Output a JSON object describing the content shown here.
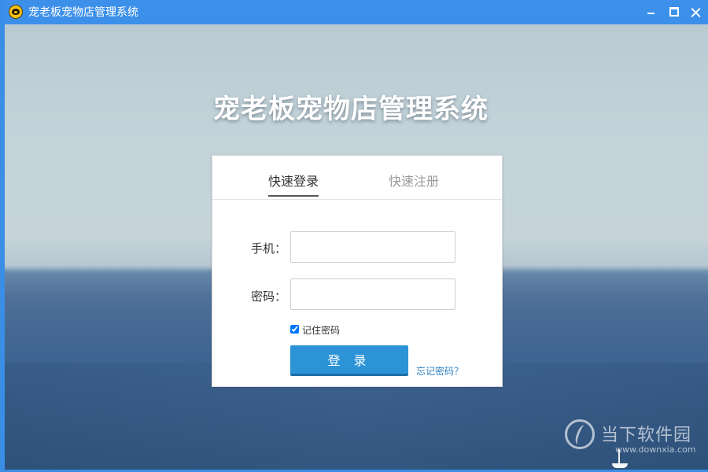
{
  "window": {
    "title": "宠老板宠物店管理系统",
    "icon": "pet-dog-icon"
  },
  "main": {
    "title": "宠老板宠物店管理系统"
  },
  "login": {
    "tabs": [
      {
        "label": "快速登录",
        "active": true
      },
      {
        "label": "快速注册",
        "active": false
      }
    ],
    "phone_label": "手机：",
    "phone_value": "",
    "password_label": "密码：",
    "password_value": "",
    "remember_label": "记住密码",
    "remember_checked": true,
    "submit_label": "登 录",
    "forgot_label": "忘记密码？"
  },
  "watermark": {
    "name": "当下软件园",
    "url": "www.downxia.com"
  },
  "colors": {
    "titlebar": "#3d90ea",
    "button": "#2b93d6",
    "link": "#2b7fc2"
  }
}
